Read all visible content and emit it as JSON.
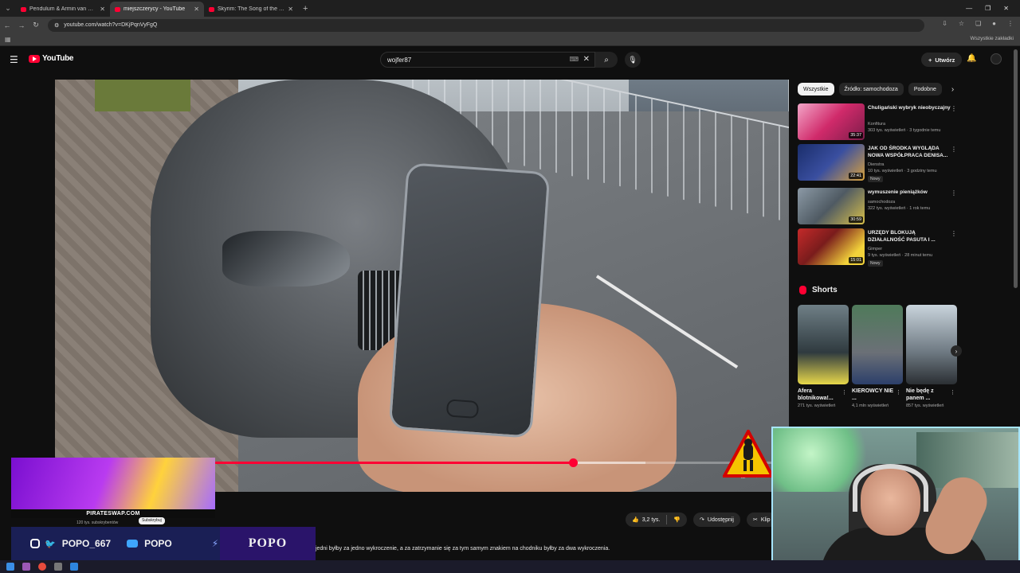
{
  "browser": {
    "tabs": [
      {
        "title": "Pendulum & Armin van Buuren",
        "active": false
      },
      {
        "title": "miejszczerycy - YouTube",
        "active": true
      },
      {
        "title": "Skyrim: The Song of the Dragon",
        "active": false
      }
    ],
    "url": "youtube.com/watch?v=DKjPqnVyFgQ",
    "bookmarks_all": "Wszystkie zakładki"
  },
  "header": {
    "logo_text": "YouTube",
    "search_value": "wojfer87",
    "create_label": "Utwórz"
  },
  "player": {
    "progress": 0.706,
    "buffered": 0.805
  },
  "actions": {
    "likes": "3,2 tys.",
    "share": "Udostępnij",
    "clip": "Klip"
  },
  "overlay": {
    "promo_site": "PIRATESWAP.COM",
    "channel_subs": "120 tys. subskrybentów",
    "subscribe": "Subskrybuj",
    "handle1": "POPO_667",
    "handle2": "POPO",
    "brand": "POPO"
  },
  "caption": "jedni byłby za jedno wykroczenie, a za zatrzymanie się za tym samym znakiem na chodniku byłby za dwa wykroczenia.",
  "chips": [
    "Wszystkie",
    "Źródło: samochodoza",
    "Podobne"
  ],
  "recommendations": [
    {
      "title": "Chuligański wybryk nieobyczajny",
      "channel": "Konfitura",
      "stats": "303 tys. wyświetleń · 3 tygodnie temu",
      "duration": "35:37",
      "badge": ""
    },
    {
      "title": "JAK OD ŚRODKA WYGLĄDA NOWA WSPÓŁPRACA DENISA...",
      "channel": "Dienstra",
      "stats": "10 tys. wyświetleń · 3 godziny temu",
      "duration": "22:41",
      "badge": "Nowy"
    },
    {
      "title": "wymuszenie pieniążków",
      "channel": "samochodoza",
      "stats": "322 tys. wyświetleń · 1 rok temu",
      "duration": "30:59",
      "badge": ""
    },
    {
      "title": "URZĘDY BLOKUJĄ DZIAŁALNOŚĆ PASUTA I ...",
      "channel": "Gimper",
      "stats": "9 tys. wyświetleń · 28 minut temu",
      "duration": "15:01",
      "badge": "Nowy"
    }
  ],
  "shorts": {
    "label": "Shorts",
    "items": [
      {
        "title": "Afera blotnikowa!...",
        "views": "271 tys. wyświetleń"
      },
      {
        "title": "KIEROWCY NIE ...",
        "views": "4,1 mln wyświetleń"
      },
      {
        "title": "Nie będę z panem ...",
        "views": "857 tys. wyświetleń"
      }
    ]
  },
  "colors": {
    "accent": "#ff0033",
    "background": "#0f0f0f"
  }
}
